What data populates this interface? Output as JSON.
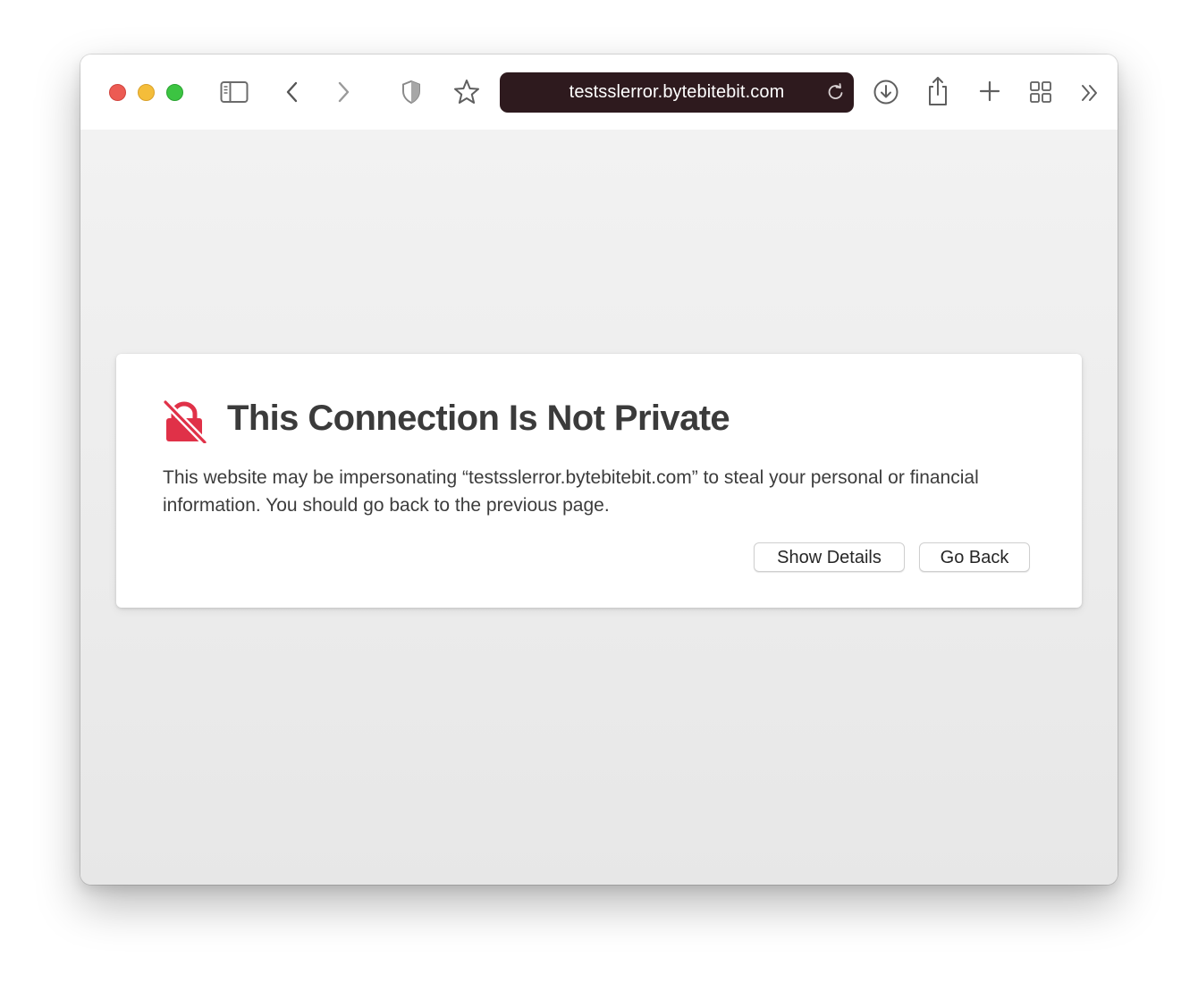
{
  "window": {
    "traffic_lights": {
      "close_color": "#ec5b53",
      "minimize_color": "#f4bd3a",
      "maximize_color": "#3cc442"
    }
  },
  "toolbar": {
    "icons": [
      "sidebar-icon",
      "back-arrow-icon",
      "forward-arrow-icon",
      "shield-icon",
      "star-icon",
      "download-icon",
      "share-icon",
      "plus-icon",
      "tab-overview-icon",
      "chevron-double-right-icon"
    ],
    "address": {
      "url": "testsslerror.bytebitebit.com",
      "background": "#2e1a1e",
      "reload_icon": "reload-icon"
    }
  },
  "warning": {
    "icon": "lock-slash-icon",
    "icon_color": "#e03148",
    "title": "This Connection Is Not Private",
    "body": "This website may be impersonating “testsslerror.bytebitebit.com” to steal your personal or financial information. You should go back to the previous page.",
    "buttons": {
      "show_details": "Show Details",
      "go_back": "Go Back"
    }
  }
}
